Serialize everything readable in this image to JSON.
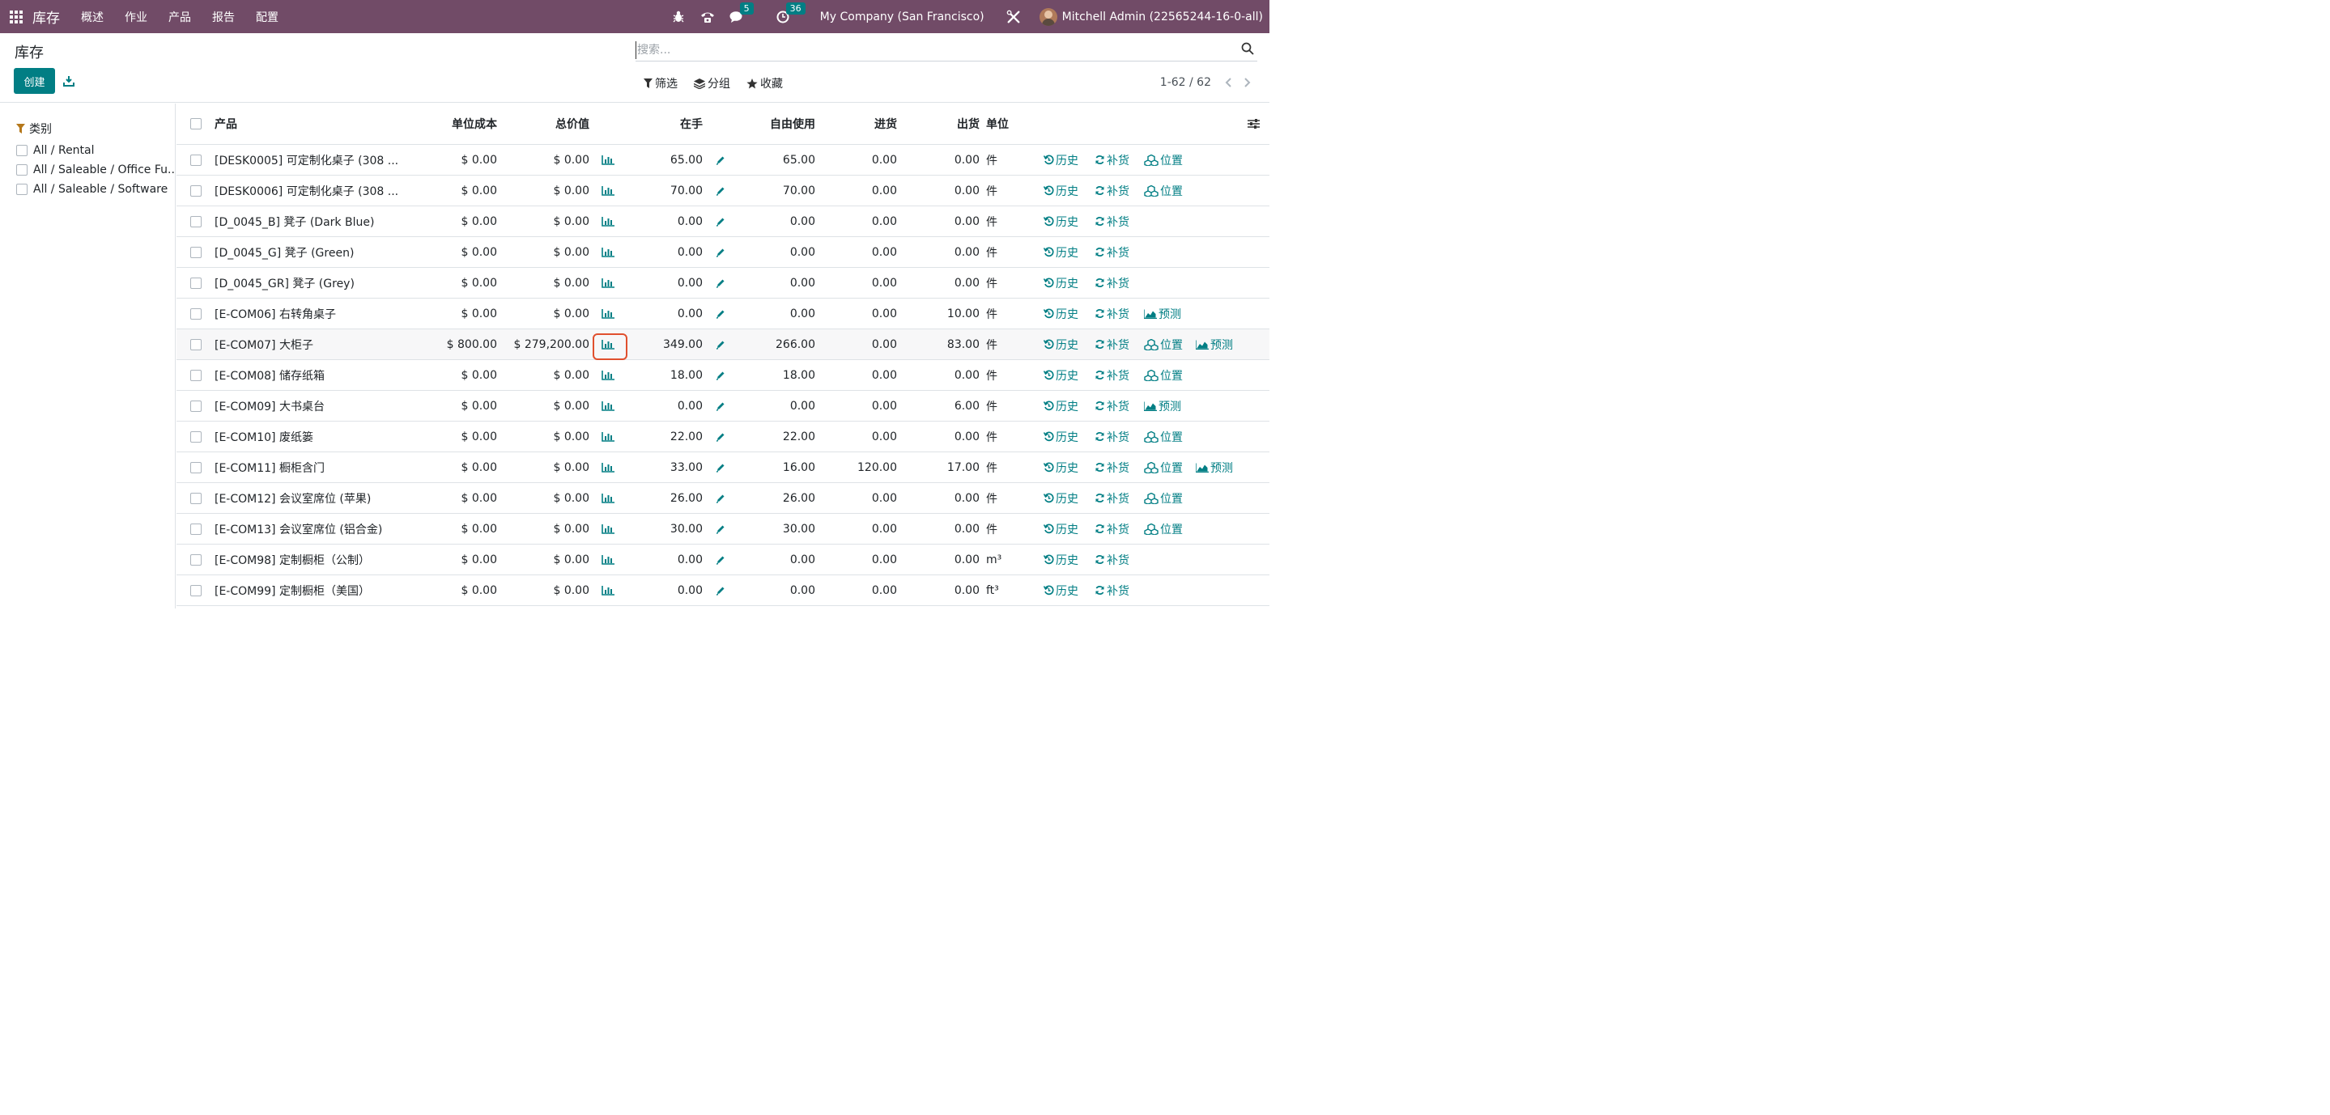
{
  "navbar": {
    "app_name": "库存",
    "menu": [
      "概述",
      "作业",
      "产品",
      "报告",
      "配置"
    ],
    "messages_count": "5",
    "activities_count": "36",
    "company": "My Company (San Francisco)",
    "user": "Mitchell Admin (22565244-16-0-all)"
  },
  "control": {
    "title": "库存",
    "create_label": "创建",
    "search_placeholder": "搜索...",
    "filter_label": "筛选",
    "group_label": "分组",
    "favorites_label": "收藏",
    "pager": "1-62 / 62"
  },
  "side": {
    "heading": "类别",
    "categories": [
      "All / Rental",
      "All / Saleable / Office Fu...",
      "All / Saleable / Software"
    ]
  },
  "columns": {
    "product": "产品",
    "unit_cost": "单位成本",
    "total_value": "总价值",
    "on_hand": "在手",
    "free": "自由使用",
    "incoming": "进货",
    "outgoing": "出货",
    "uom": "单位"
  },
  "actions": {
    "history": "历史",
    "replenish": "补货",
    "locations": "位置",
    "forecast": "预测"
  },
  "rows": [
    {
      "product": "[DESK0005] 可定制化桌子 (308 ...",
      "cost": "$ 0.00",
      "value": "$ 0.00",
      "onhand": "65.00",
      "free": "65.00",
      "incoming": "0.00",
      "outgoing": "0.00",
      "uom": "件",
      "loc": true,
      "fc": false
    },
    {
      "product": "[DESK0006] 可定制化桌子 (308 ...",
      "cost": "$ 0.00",
      "value": "$ 0.00",
      "onhand": "70.00",
      "free": "70.00",
      "incoming": "0.00",
      "outgoing": "0.00",
      "uom": "件",
      "loc": true,
      "fc": false
    },
    {
      "product": "[D_0045_B] 凳子 (Dark Blue)",
      "cost": "$ 0.00",
      "value": "$ 0.00",
      "onhand": "0.00",
      "free": "0.00",
      "incoming": "0.00",
      "outgoing": "0.00",
      "uom": "件",
      "loc": false,
      "fc": false
    },
    {
      "product": "[D_0045_G] 凳子 (Green)",
      "cost": "$ 0.00",
      "value": "$ 0.00",
      "onhand": "0.00",
      "free": "0.00",
      "incoming": "0.00",
      "outgoing": "0.00",
      "uom": "件",
      "loc": false,
      "fc": false
    },
    {
      "product": "[D_0045_GR] 凳子 (Grey)",
      "cost": "$ 0.00",
      "value": "$ 0.00",
      "onhand": "0.00",
      "free": "0.00",
      "incoming": "0.00",
      "outgoing": "0.00",
      "uom": "件",
      "loc": false,
      "fc": false
    },
    {
      "product": "[E-COM06] 右转角桌子",
      "cost": "$ 0.00",
      "value": "$ 0.00",
      "onhand": "0.00",
      "free": "0.00",
      "incoming": "0.00",
      "outgoing": "10.00",
      "uom": "件",
      "loc": false,
      "fc": true
    },
    {
      "product": "[E-COM07] 大柜子",
      "cost": "$ 800.00",
      "value": "$ 279,200.00",
      "onhand": "349.00",
      "free": "266.00",
      "incoming": "0.00",
      "outgoing": "83.00",
      "uom": "件",
      "loc": true,
      "fc": true,
      "highlight": true
    },
    {
      "product": "[E-COM08] 储存纸箱",
      "cost": "$ 0.00",
      "value": "$ 0.00",
      "onhand": "18.00",
      "free": "18.00",
      "incoming": "0.00",
      "outgoing": "0.00",
      "uom": "件",
      "loc": true,
      "fc": false
    },
    {
      "product": "[E-COM09] 大书桌台",
      "cost": "$ 0.00",
      "value": "$ 0.00",
      "onhand": "0.00",
      "free": "0.00",
      "incoming": "0.00",
      "outgoing": "6.00",
      "uom": "件",
      "loc": false,
      "fc": true
    },
    {
      "product": "[E-COM10] 废纸篓",
      "cost": "$ 0.00",
      "value": "$ 0.00",
      "onhand": "22.00",
      "free": "22.00",
      "incoming": "0.00",
      "outgoing": "0.00",
      "uom": "件",
      "loc": true,
      "fc": false
    },
    {
      "product": "[E-COM11] 橱柜含门",
      "cost": "$ 0.00",
      "value": "$ 0.00",
      "onhand": "33.00",
      "free": "16.00",
      "incoming": "120.00",
      "outgoing": "17.00",
      "uom": "件",
      "loc": true,
      "fc": true
    },
    {
      "product": "[E-COM12] 会议室席位 (苹果)",
      "cost": "$ 0.00",
      "value": "$ 0.00",
      "onhand": "26.00",
      "free": "26.00",
      "incoming": "0.00",
      "outgoing": "0.00",
      "uom": "件",
      "loc": true,
      "fc": false
    },
    {
      "product": "[E-COM13] 会议室席位 (铝合金)",
      "cost": "$ 0.00",
      "value": "$ 0.00",
      "onhand": "30.00",
      "free": "30.00",
      "incoming": "0.00",
      "outgoing": "0.00",
      "uom": "件",
      "loc": true,
      "fc": false
    },
    {
      "product": "[E-COM98] 定制橱柜（公制）",
      "cost": "$ 0.00",
      "value": "$ 0.00",
      "onhand": "0.00",
      "free": "0.00",
      "incoming": "0.00",
      "outgoing": "0.00",
      "uom": "m³",
      "loc": false,
      "fc": false
    },
    {
      "product": "[E-COM99] 定制橱柜（美国）",
      "cost": "$ 0.00",
      "value": "$ 0.00",
      "onhand": "0.00",
      "free": "0.00",
      "incoming": "0.00",
      "outgoing": "0.00",
      "uom": "ft³",
      "loc": false,
      "fc": false
    }
  ],
  "colors": {
    "navbar": "#714B67",
    "accent": "#017E84",
    "highlight_box": "#e0502e"
  }
}
